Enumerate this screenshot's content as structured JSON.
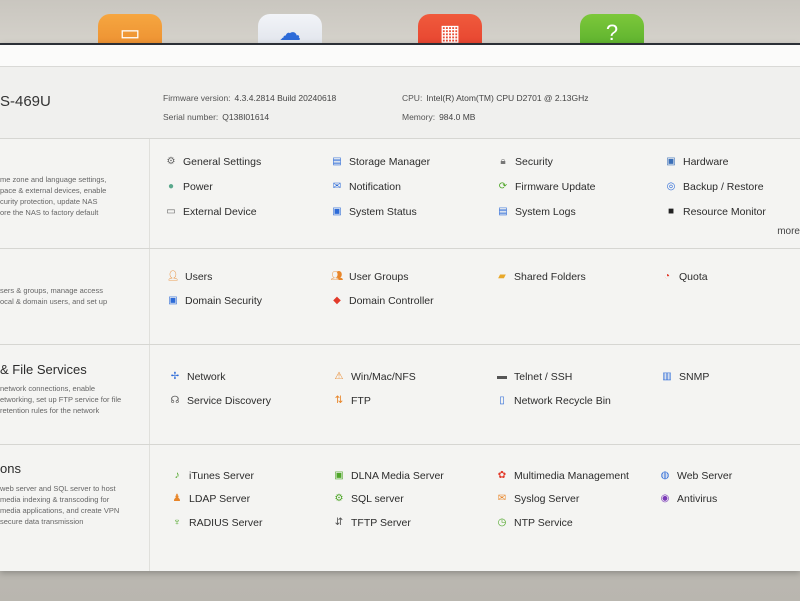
{
  "header": {
    "model": "S-469U",
    "firmware_label": "Firmware version:",
    "firmware_value": "4.3.4.2814 Build 20240618",
    "serial_label": "Serial number:",
    "serial_value": "Q138I01614",
    "cpu_label": "CPU:",
    "cpu_value": "Intel(R) Atom(TM) CPU D2701 @ 2.13GHz",
    "memory_label": "Memory:",
    "memory_value": "984.0 MB"
  },
  "sections": {
    "system": {
      "desc": [
        "me zone and language settings,",
        "pace & external devices, enable",
        "curity protection, update NAS",
        "ore the NAS to factory default"
      ],
      "items": [
        "General Settings",
        "Storage Manager",
        "Security",
        "Hardware",
        "Power",
        "Notification",
        "Firmware Update",
        "Backup / Restore",
        "External Device",
        "System Status",
        "System Logs",
        "Resource Monitor"
      ],
      "more": "more"
    },
    "privilege": {
      "desc": [
        "sers & groups, manage access",
        "ocal & domain users, and set up"
      ],
      "items": [
        "Users",
        "User Groups",
        "Shared Folders",
        "Quota",
        "Domain Security",
        "Domain Controller"
      ]
    },
    "network": {
      "title": "& File Services",
      "desc": [
        "network connections, enable",
        "etworking, set up FTP service for file",
        "retention rules for the network"
      ],
      "items": [
        "Network",
        "Win/Mac/NFS",
        "Telnet / SSH",
        "SNMP",
        "Service Discovery",
        "FTP",
        "Network Recycle Bin"
      ]
    },
    "applications": {
      "title": "ons",
      "desc": [
        "web server and SQL server to host",
        "media indexing & transcoding for",
        "media applications, and create VPN",
        "secure data transmission"
      ],
      "items": [
        "iTunes Server",
        "DLNA Media Server",
        "Multimedia Management",
        "Web Server",
        "LDAP Server",
        "SQL server",
        "Syslog Server",
        "Antivirus",
        "RADIUS Server",
        "TFTP Server",
        "NTP Service"
      ]
    }
  },
  "icons": {
    "colors": {
      "accent_blue": "#2d6bd8",
      "orange": "#e8862a",
      "green": "#4ea628",
      "red": "#e23a2a"
    }
  }
}
